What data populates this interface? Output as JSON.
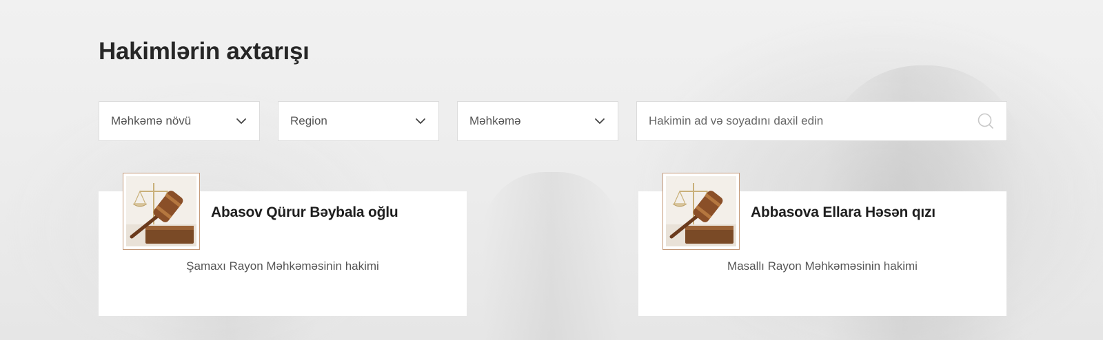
{
  "page": {
    "title": "Hakimlərin axtarışı"
  },
  "filters": {
    "court_type": {
      "label": "Məhkəmə növü",
      "icon": "chevron-down-icon"
    },
    "region": {
      "label": "Region",
      "icon": "chevron-down-icon"
    },
    "court": {
      "label": "Məhkəmə",
      "icon": "chevron-down-icon"
    }
  },
  "search": {
    "placeholder": "Hakimin ad və soyadını daxil edin",
    "value": "",
    "icon": "search-icon"
  },
  "judges": [
    {
      "name": "Abasov Qürur Bəybala oğlu",
      "court": "Şamaxı Rayon Məhkəməsinin hakimi",
      "photo_icon": "judge-gavel-icon"
    },
    {
      "name": "Abbasova Ellara Həsən qızı",
      "court": "Masallı Rayon Məhkəməsinin hakimi",
      "photo_icon": "judge-gavel-icon"
    }
  ],
  "colors": {
    "background": "#ececec",
    "card": "#ffffff",
    "title_text": "#262626",
    "muted_text": "#555555",
    "avatar_border": "#c49a7a"
  }
}
